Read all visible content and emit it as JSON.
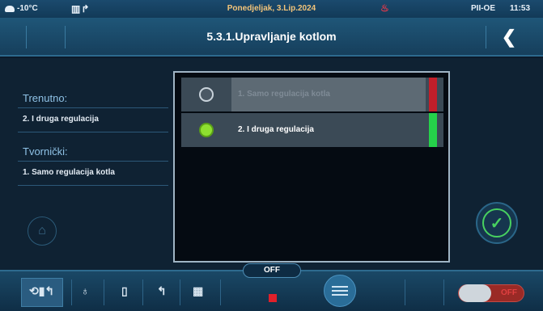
{
  "status_bar": {
    "outdoor_temp": "-10°C",
    "date": "Ponedjeljak, 3.Lip.2024",
    "mode": "PII-OE",
    "time": "11:53",
    "weather_icon": "cloud-icon",
    "heating_icon": "radiator-tap-icon",
    "alarm_icon": "alarm-flame-icon"
  },
  "header": {
    "title": "5.3.1.Upravljanje kotlom",
    "back_icon": "chevron-left-icon"
  },
  "left_panel": {
    "current_heading": "Trenutno:",
    "current_value": "2. I druga regulacija",
    "factory_heading": "Tvornički:",
    "factory_value": "1. Samo regulacija kotla",
    "home_icon": "home-icon"
  },
  "options": [
    {
      "label": "1. Samo regulacija kotla",
      "selected": false,
      "status_color": "#c21f2a"
    },
    {
      "label": "2. I druga regulacija",
      "selected": true,
      "status_color": "#25d14a"
    }
  ],
  "confirm_icon": "check-icon",
  "bottom_bar": {
    "off_label": "OFF",
    "stop_icon": "stop-icon",
    "mode_icons": [
      "auto-mode-icon",
      "flame-icon",
      "tank-icon",
      "tap-icon",
      "radiator-icon"
    ],
    "menu_icon": "menu-icon",
    "toggle_label": "OFF"
  },
  "colors": {
    "accent": "#2a6d98",
    "ok": "#25d14a",
    "error": "#c21f2a"
  }
}
